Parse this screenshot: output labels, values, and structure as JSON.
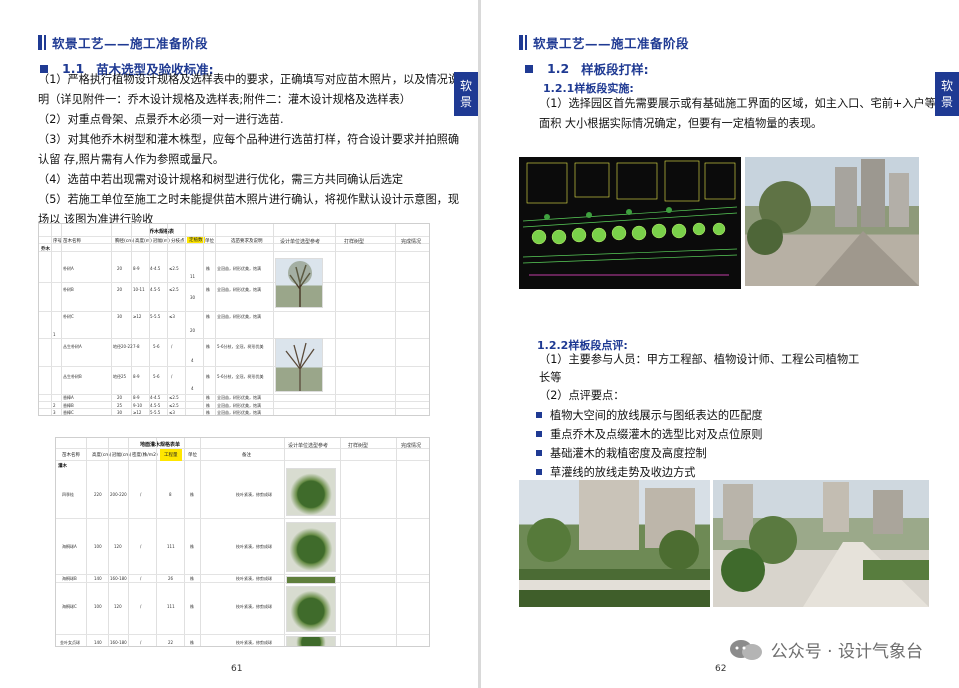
{
  "left": {
    "header": "软景工艺——施工准备阶段",
    "tab": "软景",
    "section": {
      "num": "1.1",
      "title": "苗木选型及验收标准:"
    },
    "paragraphs": [
      "（1）严格执行植物设计规格及选样表中的要求，正确填写对应苗木照片，以及情况说",
      "明（详见附件一：乔木设计规格及选样表;附件二：灌木设计规格及选样表）",
      "（2）对重点骨架、点景乔木必须一对一进行选苗.",
      "（3）对其他乔木树型和灌木株型，应每个品种进行选苗打样，符合设计要求并拍照确",
      "认留 存,照片需有人作为参照或量尺。",
      "（4）选苗中若出现需对设计规格和树型进行优化，需三方共同确认后选定",
      "（5）若施工单位至施工之时未能提供苗木照片进行确认，将视作默认设计示意图，现",
      "场以 该图为准进行验收"
    ],
    "sheet1": {
      "title": "乔木规格表",
      "headers": [
        "序号",
        "苗木名称",
        "胸径(cm)",
        "高度(m)",
        "冠幅(m)",
        "分枝点",
        "定植数",
        "单位",
        "选苗要求及说明"
      ],
      "extra_headers": [
        "设计单位选型参考",
        "打样树型",
        "完成情况"
      ],
      "group": "乔木",
      "rows": [
        {
          "name": "朴树A",
          "d": "20",
          "h": "8-9",
          "w": "4-4.5",
          "b": "≤2.5",
          "q": "11",
          "u": "株",
          "note": "全冠苗，树形优美，饱满"
        },
        {
          "name": "朴树B",
          "d": "20",
          "h": "10-11",
          "w": "4.5-5",
          "b": "≤2.5",
          "q": "30",
          "u": "株",
          "note": "全冠苗，树形优美，饱满"
        },
        {
          "name": "朴树C",
          "d": "30",
          "h": "≥12",
          "w": "5-5.5",
          "b": "≤3",
          "q": "20",
          "u": "株",
          "note": "全冠苗，树形优美，饱满"
        },
        {
          "name": "丛生朴树A",
          "d": "地径20-22",
          "h": "7-8",
          "w": "5-6",
          "b": "/",
          "q": "4",
          "u": "株",
          "note": "5-6分枝，全冠，树形优美"
        },
        {
          "name": "丛生朴树B",
          "d": "地径25",
          "h": "8-9",
          "w": "5-6",
          "b": "/",
          "q": "4",
          "u": "株",
          "note": "5-6分枝，全冠，树形优美"
        },
        {
          "name": "香樟A",
          "d": "20",
          "h": "8-9",
          "w": "4-4.5",
          "b": "≤2.5",
          "q": "",
          "u": "株",
          "note": "全冠苗，树形优美，饱满"
        },
        {
          "name": "香樟B",
          "d": "25",
          "h": "9-10",
          "w": "4.5-5",
          "b": "≤2.5",
          "q": "",
          "u": "株",
          "note": "全冠苗，树形优美，饱满"
        },
        {
          "name": "香樟C",
          "d": "30",
          "h": "≥12",
          "w": "5-5.5",
          "b": "≤3",
          "q": "",
          "u": "株",
          "note": "全冠苗，树形优美，饱满"
        }
      ],
      "index": [
        "1",
        "2",
        "3"
      ]
    },
    "sheet2": {
      "title": "地面灌木规格表单",
      "headers": [
        "苗木名称",
        "高度(cm)",
        "冠幅(cm)",
        "密度(株/m2)",
        "工程量",
        "单位",
        "备注"
      ],
      "extra_headers": [
        "设计单位选型参考",
        "打样树型",
        "完成情况"
      ],
      "group": "灌木",
      "rows": [
        {
          "name": "四季桂",
          "h": "220",
          "w": "200-220",
          "d": "/",
          "q": "8",
          "u": "株",
          "note": "枝叶紧凑，修剪成球"
        },
        {
          "name": "海桐球A",
          "h": "100",
          "w": "120",
          "d": "/",
          "q": "111",
          "u": "株",
          "note": "枝叶紧凑，修剪成球"
        },
        {
          "name": "海桐球B",
          "h": "140",
          "w": "160-180",
          "d": "/",
          "q": "26",
          "u": "株",
          "note": "枝叶紧凑，修剪成球"
        },
        {
          "name": "海桐球C",
          "h": "100",
          "w": "120",
          "d": "/",
          "q": "111",
          "u": "株",
          "note": "枝叶紧凑，修剪成球"
        },
        {
          "name": "金叶女贞球",
          "h": "140",
          "w": "160-180",
          "d": "/",
          "q": "22",
          "u": "株",
          "note": "枝叶紧凑，修剪成球"
        }
      ]
    },
    "page_number": "61"
  },
  "right": {
    "header": "软景工艺——施工准备阶段",
    "tab": "软景",
    "section": {
      "num": "1.2",
      "title": "样板段打样:"
    },
    "sub1": "1.2.1样板段实施:",
    "sub1_paragraphs": [
      "（1）选择园区首先需要展示或有基础施工界面的区域，如主入口、宅前+入户等。",
      "面积 大小根据实际情况确定，但要有一定植物量的表现。"
    ],
    "sub2": "1.2.2样板段点评:",
    "sub2_paragraphs": [
      "（1）主要参与人员：甲方工程部、植物设计师、工程公司植物工",
      "长等",
      "（2）点评要点："
    ],
    "bullets": [
      "植物大空间的放线展示与图纸表达的匹配度",
      "重点乔木及点缀灌木的选型比对及点位原则",
      "基础灌木的栽植密度及高度控制",
      "草灌线的放线走势及收边方式"
    ],
    "page_number": "62"
  },
  "watermark": "公众号 · 设计气象台",
  "colors": {
    "accent": "#1f3a93",
    "highlight": "#ffe600"
  }
}
